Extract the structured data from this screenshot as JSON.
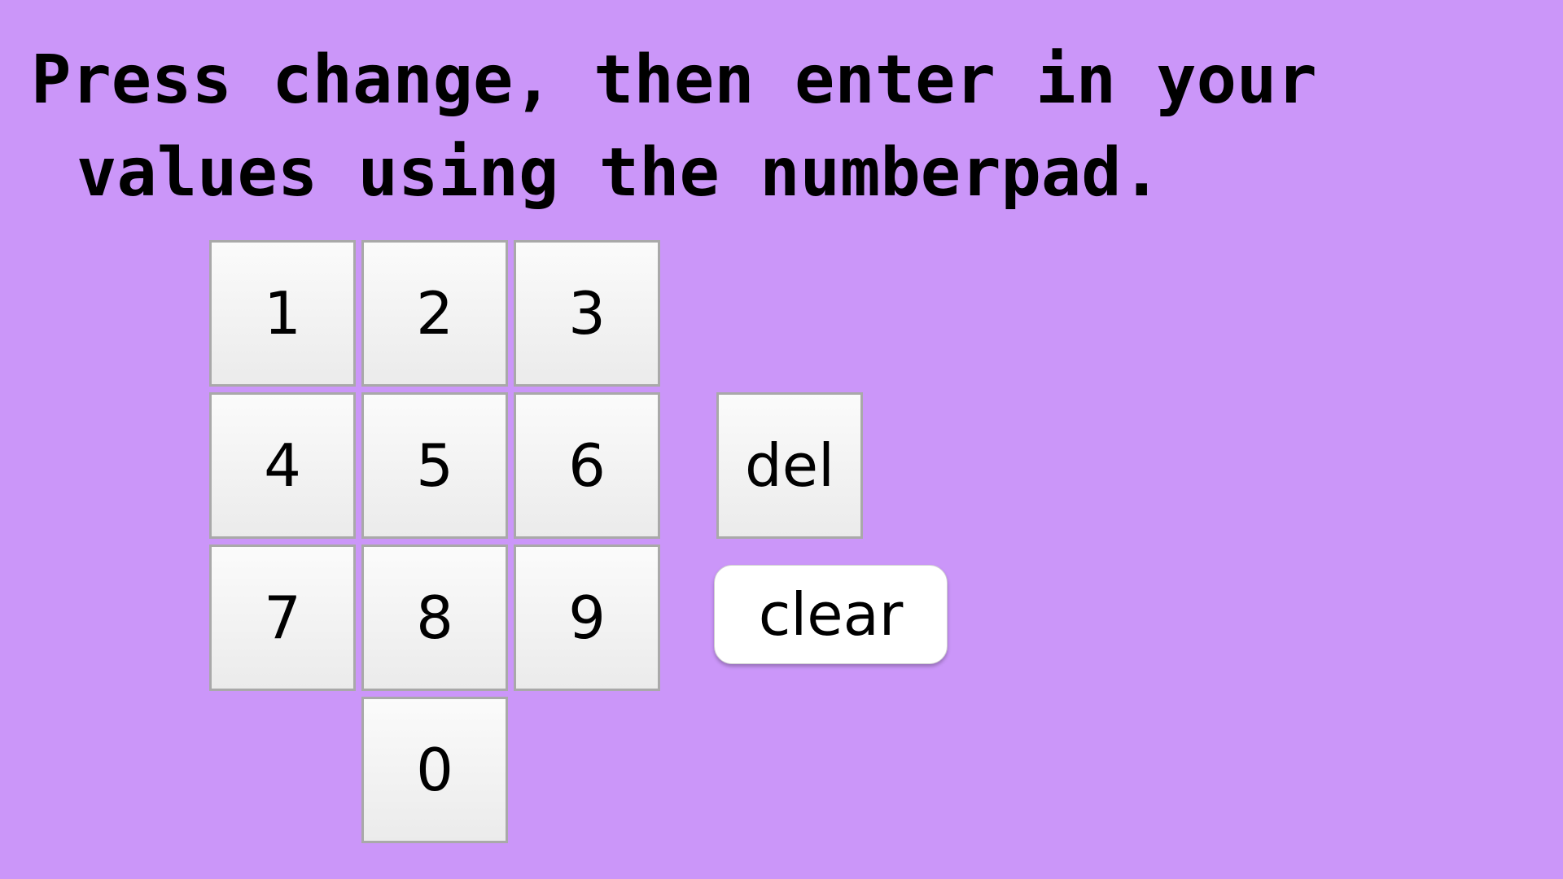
{
  "instructions": {
    "line1": "Press change, then enter in your",
    "line2": "values using the numberpad."
  },
  "numberpad": {
    "keys": [
      "1",
      "2",
      "3",
      "4",
      "5",
      "6",
      "7",
      "8",
      "9",
      "0"
    ]
  },
  "controls": {
    "del_label": "del",
    "clear_label": "clear"
  },
  "colors": {
    "background": "#cb96f9",
    "key_face": "#f2f2f2",
    "key_border": "#a9a9a9"
  }
}
